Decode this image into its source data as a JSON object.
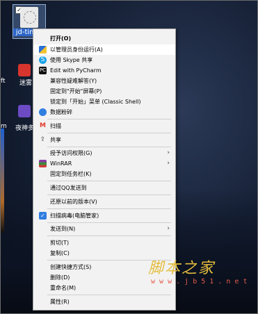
{
  "desktop": {
    "selected_file": {
      "name": "jd-time."
    },
    "icons": [
      {
        "label": "ft"
      },
      {
        "label": "迷雾"
      },
      {
        "label": "m"
      },
      {
        "label": "夜神多开"
      }
    ]
  },
  "context_menu": {
    "items": [
      {
        "label": "打开(O)",
        "icon": ""
      },
      {
        "label": "以管理员身份运行(A)",
        "icon": "shield-icon"
      },
      {
        "label": "使用 Skype 共享",
        "icon": "skype-icon"
      },
      {
        "label": "Edit with PyCharm",
        "icon": "pycharm-icon"
      },
      {
        "label": "兼容性疑难解答(Y)",
        "icon": ""
      },
      {
        "label": "固定到\"开始\"屏幕(P)",
        "icon": ""
      },
      {
        "label": "锁定到「开始」菜单 (Classic Shell)",
        "icon": ""
      },
      {
        "label": "数据粉碎",
        "icon": "shred-icon"
      },
      {
        "label": "扫描",
        "icon": "scan-icon"
      },
      {
        "label": "共享",
        "icon": "share-icon"
      },
      {
        "label": "授予访问权限(G)",
        "icon": ""
      },
      {
        "label": "WinRAR",
        "icon": "winrar-icon"
      },
      {
        "label": "固定到任务栏(K)",
        "icon": ""
      },
      {
        "label": "通过QQ发送到",
        "icon": ""
      },
      {
        "label": "还原以前的版本(V)",
        "icon": ""
      },
      {
        "label": "扫描病毒(电脑管家)",
        "icon": "antivirus-icon"
      },
      {
        "label": "发送到(N)",
        "icon": ""
      },
      {
        "label": "剪切(T)",
        "icon": ""
      },
      {
        "label": "复制(C)",
        "icon": ""
      },
      {
        "label": "创建快捷方式(S)",
        "icon": ""
      },
      {
        "label": "删除(D)",
        "icon": ""
      },
      {
        "label": "重命名(M)",
        "icon": ""
      },
      {
        "label": "属性(R)",
        "icon": ""
      }
    ]
  },
  "watermark": {
    "title": "脚本之家",
    "url": "w w w . j b 5 1 . n e t"
  },
  "colors": {
    "menu_bg": "#f2f2f2",
    "selection_blue": "#2d66c8",
    "watermark_gold": "#e4bd3d",
    "watermark_red": "#e45b4c"
  }
}
